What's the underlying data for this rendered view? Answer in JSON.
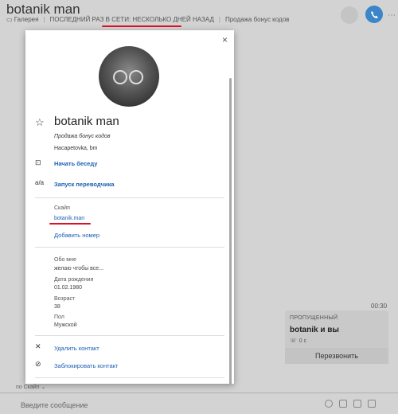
{
  "background": {
    "title": "botanik man",
    "gallery": "Галерея",
    "last_seen": "ПОСЛЕДНИЙ РАЗ В СЕТИ: НЕСКОЛЬКО ДНЕЙ НАЗАД",
    "status": "Продажа бонус кодов",
    "time": "00:30",
    "missed_label": "ПРОПУЩЕННЫЙ",
    "missed_name": "botanik и вы",
    "missed_duration": "0 с",
    "callback": "Перезвонить",
    "via": "по Скайп",
    "input_placeholder": "Введите сообщение"
  },
  "profile": {
    "close": "×",
    "name": "botanik man",
    "status": "Продажа бонус кодов",
    "location": "Насаpetovka, bm",
    "start_chat": "Начать беседу",
    "start_translator": "Запуск переводчика",
    "skype_label": "Скайп",
    "skype_id": "botanik.man",
    "add_number": "Добавить номер",
    "about_label": "Обо мне",
    "about_value": "желаю чтобы все...",
    "birthday_label": "Дата рождения",
    "birthday_value": "01.02.1980",
    "age_label": "Возраст",
    "age_value": "38",
    "gender_label": "Пол",
    "gender_value": "Мужской",
    "remove_contact": "Удалить контакт",
    "block_contact": "Заблокировать контакт"
  },
  "colors": {
    "accent": "#1a5fb4",
    "underline": "#dd1122"
  }
}
